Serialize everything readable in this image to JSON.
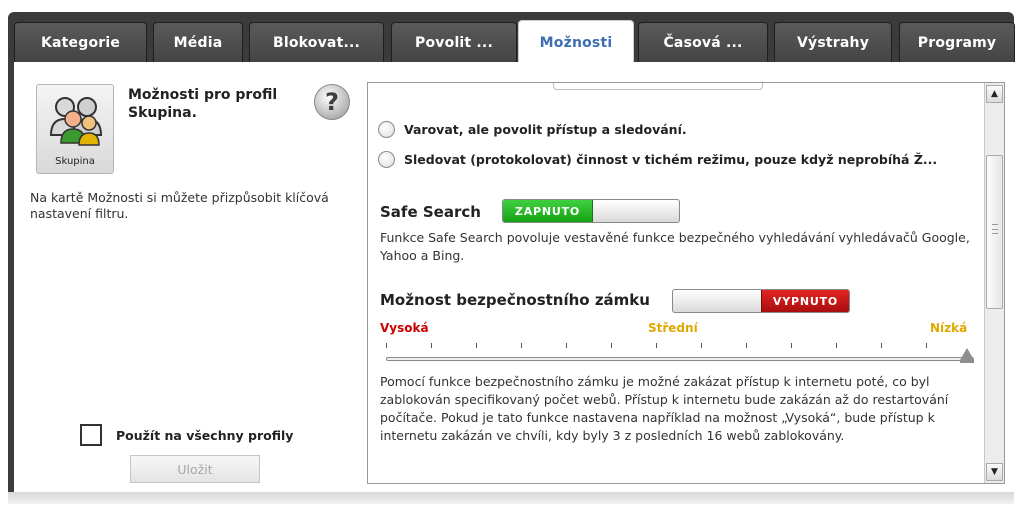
{
  "tabs": [
    {
      "label": "Kategorie",
      "active": false
    },
    {
      "label": "Média",
      "active": false
    },
    {
      "label": "Blokovat...",
      "active": false
    },
    {
      "label": "Povolit ...",
      "active": false
    },
    {
      "label": "Možnosti",
      "active": true
    },
    {
      "label": "Časová ...",
      "active": false
    },
    {
      "label": "Výstrahy",
      "active": false
    },
    {
      "label": "Programy",
      "active": false
    }
  ],
  "left_panel": {
    "profile_label": "Skupina",
    "title": "Možnosti pro profil Skupina.",
    "help_icon": "?",
    "description": "Na kartě Možnosti si můžete přizpůsobit klíčová nastavení filtru.",
    "apply_all_label": "Použít na všechny profily",
    "apply_all_checked": false,
    "save_label": "Uložit"
  },
  "options": {
    "radio_1": "Varovat, ale povolit přístup a sledování.",
    "radio_2": "Sledovat (protokolovat) činnost v tichém režimu, pouze když neprobíhá Ž...",
    "safe_search": {
      "title": "Safe Search",
      "state": "ZAPNUTO",
      "description": "Funkce Safe Search povoluje vestavěné funkce bezpečného vyhledávání vyhledávačů Google, Yahoo a Bing."
    },
    "security_lock": {
      "title": "Možnost bezpečnostního zámku",
      "state": "VYPNUTO",
      "levels": {
        "high": "Vysoká",
        "medium": "Střední",
        "low": "Nízká"
      },
      "level_colors": {
        "high": "#cc0000",
        "medium": "#e0a800",
        "low": "#e0a800"
      },
      "slider_value": 1.0,
      "description": "Pomocí funkce bezpečnostního zámku je možné zakázat přístup k internetu poté, co byl zablokován specifikovaný počet webů.  Přístup k internetu bude zakázán až do restartování počítače.  Pokud je tato funkce nastavena například na možnost „Vysoká“, bude přístup k internetu zakázán ve chvíli, kdy byly 3 z posledních 16 webů zablokovány."
    }
  },
  "colors": {
    "on": "#1db31d",
    "off": "#c41212",
    "active_tab_text": "#3f6fb0"
  }
}
